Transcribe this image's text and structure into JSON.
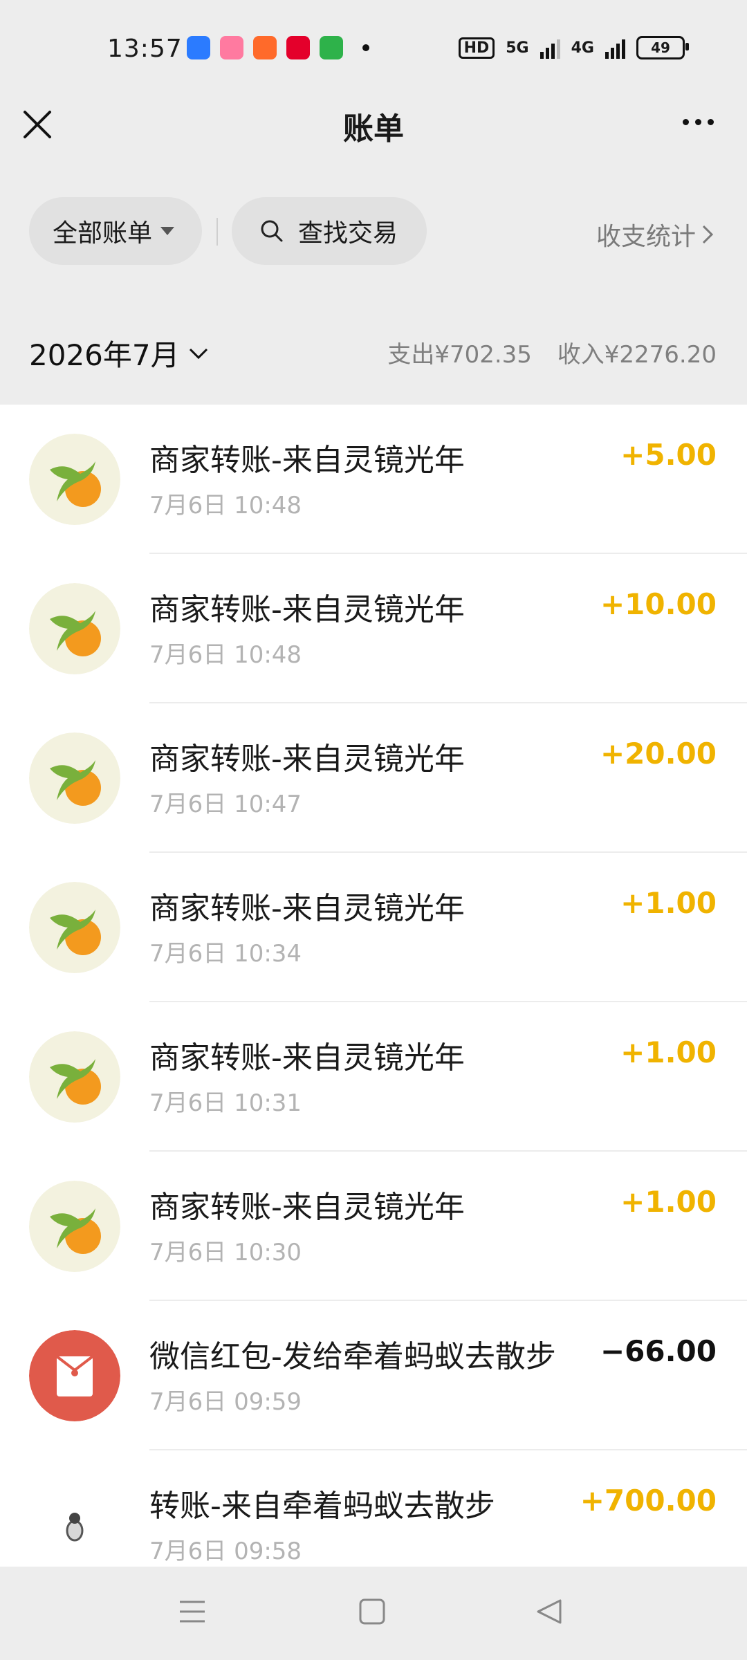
{
  "status": {
    "time": "13:57",
    "hd": "HD",
    "net1": "5G",
    "net2": "4G",
    "battery": "49"
  },
  "header": {
    "title": "账单"
  },
  "filters": {
    "all_bills": "全部账单",
    "search": "查找交易",
    "stats": "收支统计"
  },
  "summary": {
    "month": "2026年7月",
    "expense": "支出¥702.35",
    "income": "收入¥2276.20"
  },
  "transactions": [
    {
      "name": "商家转账-来自灵镜光年",
      "time": "7月6日 10:48",
      "amount": "+5.00",
      "icon": "merchant-bird-orange-icon"
    },
    {
      "name": "商家转账-来自灵镜光年",
      "time": "7月6日 10:48",
      "amount": "+10.00",
      "icon": "merchant-bird-orange-icon"
    },
    {
      "name": "商家转账-来自灵镜光年",
      "time": "7月6日 10:47",
      "amount": "+20.00",
      "icon": "merchant-bird-orange-icon"
    },
    {
      "name": "商家转账-来自灵镜光年",
      "time": "7月6日 10:34",
      "amount": "+1.00",
      "icon": "merchant-bird-orange-icon"
    },
    {
      "name": "商家转账-来自灵镜光年",
      "time": "7月6日 10:31",
      "amount": "+1.00",
      "icon": "merchant-bird-orange-icon"
    },
    {
      "name": "商家转账-来自灵镜光年",
      "time": "7月6日 10:30",
      "amount": "+1.00",
      "icon": "merchant-bird-orange-icon"
    },
    {
      "name": "微信红包-发给牵着蚂蚁去散步",
      "time": "7月6日 09:59",
      "amount": "−66.00",
      "icon": "red-packet-icon"
    },
    {
      "name": "转账-来自牵着蚂蚁去散步",
      "time": "7月6日 09:58",
      "amount": "+700.00",
      "icon": "user-avatar-icon"
    }
  ],
  "colors": {
    "income": "#f0b300",
    "expense": "#111111",
    "red_packet": "#e05a4b"
  }
}
